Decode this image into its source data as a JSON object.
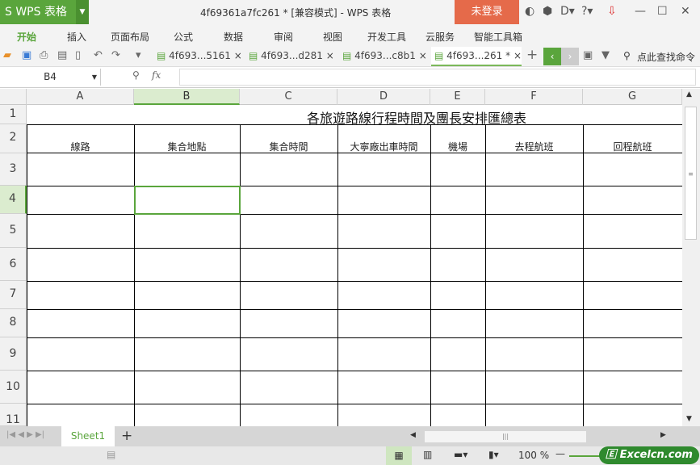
{
  "app": {
    "logo": "S WPS 表格",
    "title": "4f69361a7fc261 * [兼容模式] - WPS 表格",
    "login": "未登录"
  },
  "menu": [
    "开始",
    "插入",
    "页面布局",
    "公式",
    "数据",
    "审阅",
    "视图",
    "开发工具",
    "云服务",
    "智能工具箱"
  ],
  "doc_tabs": [
    "4f693...5161",
    "4f693...d281",
    "4f693...c8b1",
    "4f693...261 *"
  ],
  "search_cmd": "点此查找命令",
  "formula": {
    "namebox": "B4",
    "fx": "fx",
    "value": ""
  },
  "columns": [
    "A",
    "B",
    "C",
    "D",
    "E",
    "F",
    "G"
  ],
  "rows": [
    "1",
    "2",
    "3",
    "4",
    "5",
    "6",
    "7",
    "8",
    "9",
    "10",
    "11"
  ],
  "sheet": {
    "title": "各旅遊路線行程時間及團長安排匯總表",
    "headers": [
      "線路",
      "集合地點",
      "集合時間",
      "大寧廠出車時間",
      "機場",
      "去程航班",
      "回程航班"
    ]
  },
  "sheet_tabs": [
    "Sheet1"
  ],
  "status": {
    "zoom": "100 %"
  },
  "watermark": "Excelcn.com",
  "colors": {
    "accent": "#5aa53c",
    "login": "#e56a4a"
  }
}
